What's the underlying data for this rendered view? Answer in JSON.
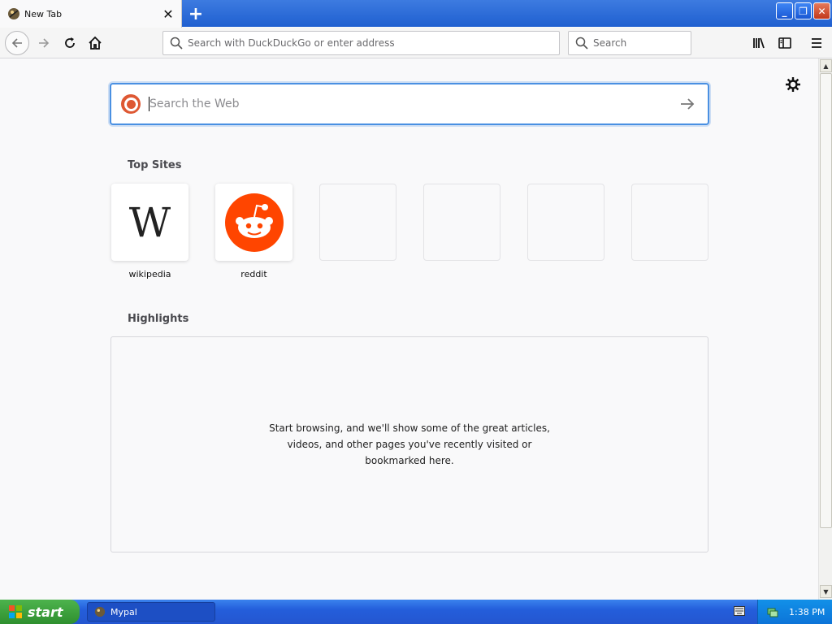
{
  "window": {
    "tab_title": "New Tab",
    "new_tab_label": "+",
    "min_label": "_",
    "max_label": "❐",
    "close_label": "✕"
  },
  "navbar": {
    "url_placeholder": "Search with DuckDuckGo or enter address",
    "search_placeholder": "Search"
  },
  "content": {
    "web_search_placeholder": "Search the Web",
    "top_sites_title": "Top Sites",
    "top_sites": [
      {
        "label": "wikipedia",
        "icon": "wikipedia-icon"
      },
      {
        "label": "reddit",
        "icon": "reddit-icon"
      }
    ],
    "highlights_title": "Highlights",
    "highlights_message": "Start browsing, and we'll show some of the great articles, videos, and other pages you've recently visited or bookmarked here."
  },
  "taskbar": {
    "start_label": "start",
    "task_item_label": "Mypal",
    "clock": "1:38 PM"
  },
  "colors": {
    "accent": "#4a90e2",
    "reddit": "#ff4500",
    "duckduckgo": "#de5833"
  }
}
